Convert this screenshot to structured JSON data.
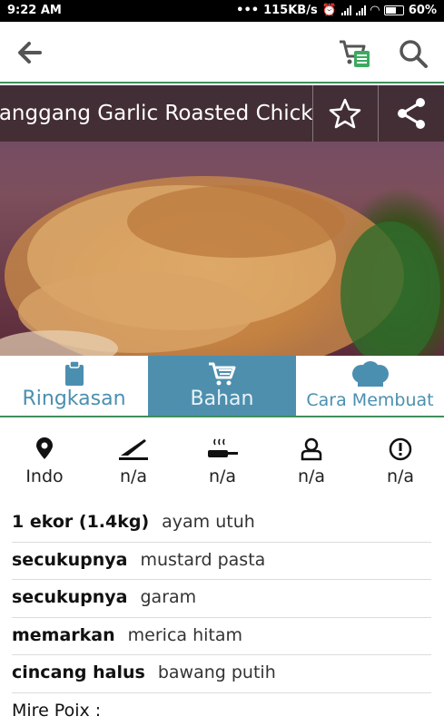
{
  "status_bar": {
    "time": "9:22 AM",
    "speed": "115KB/s",
    "battery": "60%"
  },
  "app_bar": {
    "back_icon": "arrow-left-icon",
    "cart_icon": "shopping-list-icon",
    "search_icon": "search-icon",
    "accent": "#3f8f5a"
  },
  "recipe": {
    "title": "Panggang Garlic Roasted Chicken",
    "favorite_icon": "star-outline-icon",
    "share_icon": "share-icon"
  },
  "tabs": [
    {
      "label": "Ringkasan",
      "icon": "clipboard-icon",
      "active": false
    },
    {
      "label": "Bahan",
      "icon": "cart-icon",
      "active": true
    },
    {
      "label": "Cara Membuat",
      "icon": "chef-hat-icon",
      "active": false
    }
  ],
  "tab_color": "#4e8fae",
  "meta": [
    {
      "icon": "location-pin-icon",
      "value": "Indo"
    },
    {
      "icon": "knife-icon",
      "value": "n/a"
    },
    {
      "icon": "pan-icon",
      "value": "n/a"
    },
    {
      "icon": "chef-person-icon",
      "value": "n/a"
    },
    {
      "icon": "alert-circle-icon",
      "value": "n/a"
    }
  ],
  "ingredients": [
    {
      "qty": "1 ekor (1.4kg)",
      "name": "ayam utuh"
    },
    {
      "qty": "secukupnya",
      "name": "mustard pasta"
    },
    {
      "qty": "secukupnya",
      "name": "garam"
    },
    {
      "qty": "memarkan",
      "name": "merica hitam"
    },
    {
      "qty": "cincang halus",
      "name": "bawang putih"
    },
    {
      "qty": "Mire Poix :",
      "name": ""
    }
  ]
}
